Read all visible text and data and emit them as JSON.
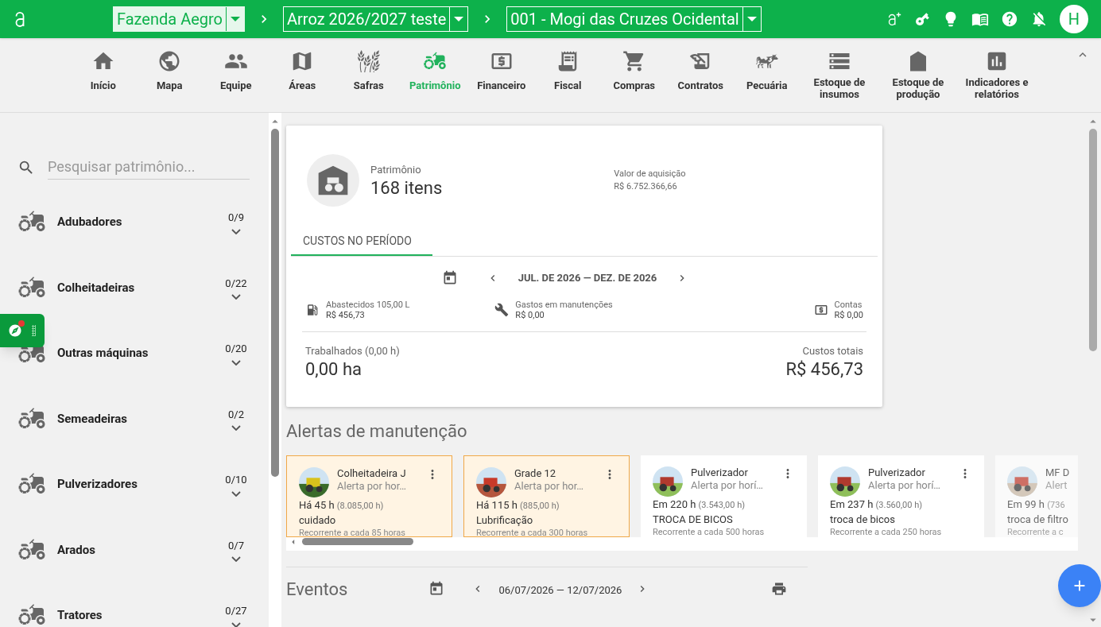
{
  "topbar": {
    "breadcrumbs": [
      {
        "label": "Fazenda Aegro",
        "highlighted": true
      },
      {
        "label": "Arroz 2026/2027 teste",
        "highlighted": false
      },
      {
        "label": "001 - Mogi das Cruzes Ocidental",
        "highlighted": false
      }
    ],
    "avatar": "H"
  },
  "nav": [
    {
      "label": "Início",
      "selected": false
    },
    {
      "label": "Mapa",
      "selected": false
    },
    {
      "label": "Equipe",
      "selected": false
    },
    {
      "label": "Áreas",
      "selected": false
    },
    {
      "label": "Safras",
      "selected": false
    },
    {
      "label": "Patrimônio",
      "selected": true
    },
    {
      "label": "Financeiro",
      "selected": false
    },
    {
      "label": "Fiscal",
      "selected": false
    },
    {
      "label": "Compras",
      "selected": false
    },
    {
      "label": "Contratos",
      "selected": false
    },
    {
      "label": "Pecuária",
      "selected": false
    },
    {
      "label": "Estoque de insumos",
      "selected": false
    },
    {
      "label": "Estoque de produção",
      "selected": false
    },
    {
      "label": "Indicadores e relatórios",
      "selected": false
    }
  ],
  "sidebar": {
    "search": {
      "placeholder": "Pesquisar patrimônio..."
    },
    "groups": [
      {
        "label": "Adubadores",
        "count": "0/9"
      },
      {
        "label": "Colheitadeiras",
        "count": "0/22"
      },
      {
        "label": "Outras máquinas",
        "count": "0/20"
      },
      {
        "label": "Semeadeiras",
        "count": "0/2"
      },
      {
        "label": "Pulverizadores",
        "count": "0/10"
      },
      {
        "label": "Arados",
        "count": "0/7"
      },
      {
        "label": "Tratores",
        "count": "0/27"
      }
    ]
  },
  "summary": {
    "caption": "Patrimônio",
    "total": "168 itens",
    "acquisition_label": "Valor de aquisição",
    "acquisition_value": "R$ 6.752.366,66",
    "tab": "CUSTOS NO PERÍODO",
    "period": "JUL. DE 2026 — DEZ. DE 2026",
    "costs": [
      {
        "kind": "fuel",
        "label": "Abastecidos 105,00 L",
        "value": "R$ 456,73"
      },
      {
        "kind": "maintenance",
        "label": "Gastos em manutenções",
        "value": "R$ 0,00"
      },
      {
        "kind": "bills",
        "label": "Contas",
        "value": "R$ 0,00"
      }
    ],
    "worked_label": "Trabalhados (0,00 h)",
    "worked_value": "0,00 ha",
    "total_label": "Custos totais",
    "total_value": "R$ 456,73"
  },
  "alerts": {
    "title": "Alertas de manutenção",
    "items": [
      {
        "title": "Colheitadeira J",
        "subtitle": "Alerta por hor…",
        "when": "Há 45 h",
        "hours": "(8.085,00 h)",
        "task": "cuidado",
        "recurrence": "Recorrente a cada 85 horas",
        "overdue": true,
        "faded": false
      },
      {
        "title": "Grade 12",
        "subtitle": "Alerta por hor…",
        "when": "Há 115 h",
        "hours": "(885,00 h)",
        "task": "Lubrificação",
        "recurrence": "Recorrente a cada 300 horas",
        "overdue": true,
        "faded": false
      },
      {
        "title": "Pulverizador",
        "subtitle": "Alerta por horí…",
        "when": "Em 220 h",
        "hours": "(3.543,00 h)",
        "task": "TROCA DE BICOS",
        "recurrence": "Recorrente a cada 500 horas",
        "overdue": false,
        "faded": false
      },
      {
        "title": "Pulverizador",
        "subtitle": "Alerta por horí…",
        "when": "Em 237 h",
        "hours": "(3.560,00 h)",
        "task": "troca de bicos",
        "recurrence": "Recorrente a cada 250 horas",
        "overdue": false,
        "faded": false
      },
      {
        "title": "MF D",
        "subtitle": "Alert",
        "when": "Em 99 h",
        "hours": "(736",
        "task": "troca de filtro",
        "recurrence": "Recorrente a c",
        "overdue": false,
        "faded": true
      }
    ]
  },
  "events": {
    "title": "Eventos",
    "period": "06/07/2026 — 12/07/2026"
  }
}
